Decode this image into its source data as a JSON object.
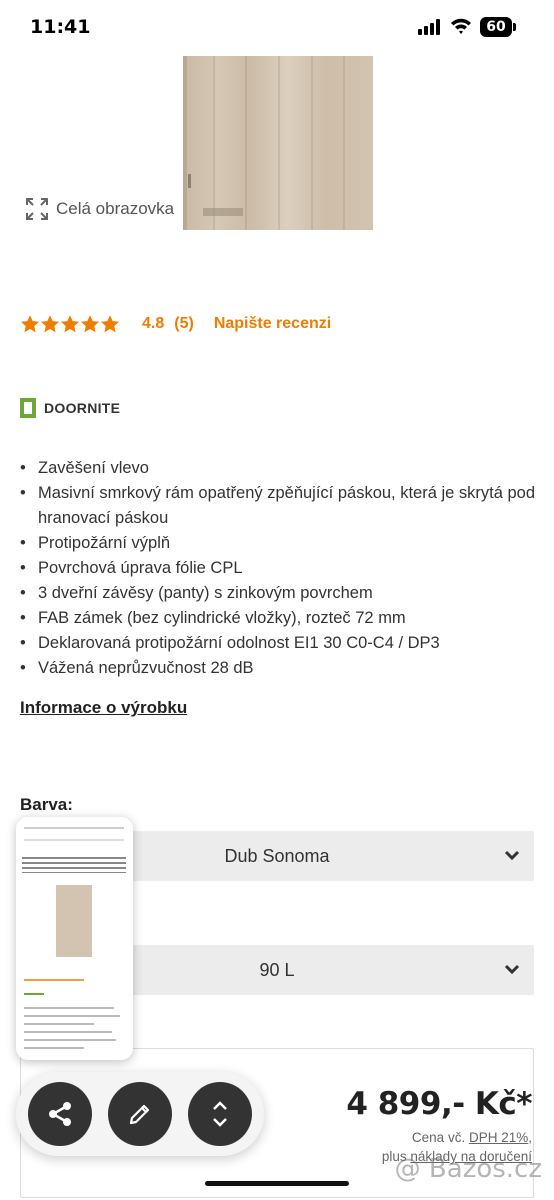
{
  "status_bar": {
    "time": "11:41",
    "battery": "60"
  },
  "gallery": {
    "fullscreen_label": "Celá obrazovka"
  },
  "rating": {
    "stars": 5,
    "value": "4.8",
    "count": "(5)",
    "write_review": "Napište recenzi",
    "color": "#f07c00"
  },
  "brand": {
    "name": "DOORNITE",
    "logo_color": "#6aa83a"
  },
  "features": [
    "Zavěšení vlevo",
    "Masivní smrkový rám opatřený zpěňující páskou, která je skrytá pod hranovací páskou",
    "Protipožární výplň",
    "Povrchová úprava fólie CPL",
    "3 dveřní závěsy (panty) s zinkovým povrchem",
    "FAB zámek (bez cylindrické vložky), rozteč 72 mm",
    "Deklarovaná protipožární odolnost EI1 30 C0-C4 / DP3",
    "Vážená neprůzvučnost 28 dB"
  ],
  "info_link": "Informace o výrobku",
  "color_select": {
    "label": "Barva:",
    "value": "Dub Sonoma"
  },
  "size_select": {
    "value": "90 L"
  },
  "price": {
    "amount": "4 899,- Kč*",
    "note_prefix": "Cena vč. ",
    "note_vat": "DPH 21%",
    "note_suffix": ",",
    "shipping_prefix": "plus ",
    "shipping_link": "náklady na doručení"
  },
  "watermark": "@ Bazos.cz",
  "icons": {
    "share": "share-icon",
    "edit": "pencil-icon",
    "expand": "expand-vertical-icon"
  }
}
